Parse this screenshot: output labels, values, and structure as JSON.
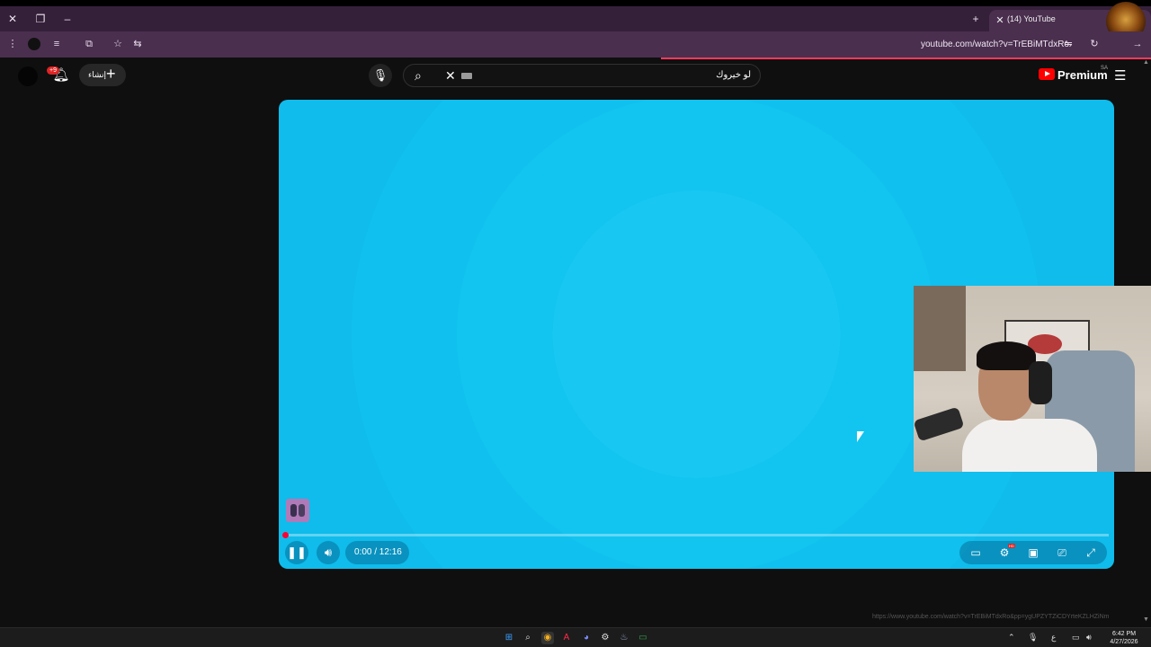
{
  "browser": {
    "window_controls": {
      "close": "✕",
      "restore": "❐",
      "minimize": "–"
    },
    "new_tab": "+",
    "tab": {
      "title": "(14) YouTube",
      "close": "✕"
    },
    "url": "youtube.com/watch?v=TrEBiMTdxRo",
    "status_url": "https://www.youtube.com/watch?v=TrEBiMTdxRo&pp=ygUPZYTZiCDYrteKZLHZiNm"
  },
  "youtube": {
    "notifications_badge": "+9",
    "create_label": "إنشاء",
    "search_value": "لو خيروك",
    "logo_text": "Premium",
    "country_code": "SA",
    "colors": {
      "brand": "#ff0000",
      "player_bg": "#12c4f0",
      "progress": "#ff0033"
    }
  },
  "player": {
    "time": "0:00 / 12:16",
    "progress_fraction": 0.0
  },
  "taskbar": {
    "time": "6:42 PM",
    "date": "4/27/2026",
    "lang": "ع"
  }
}
